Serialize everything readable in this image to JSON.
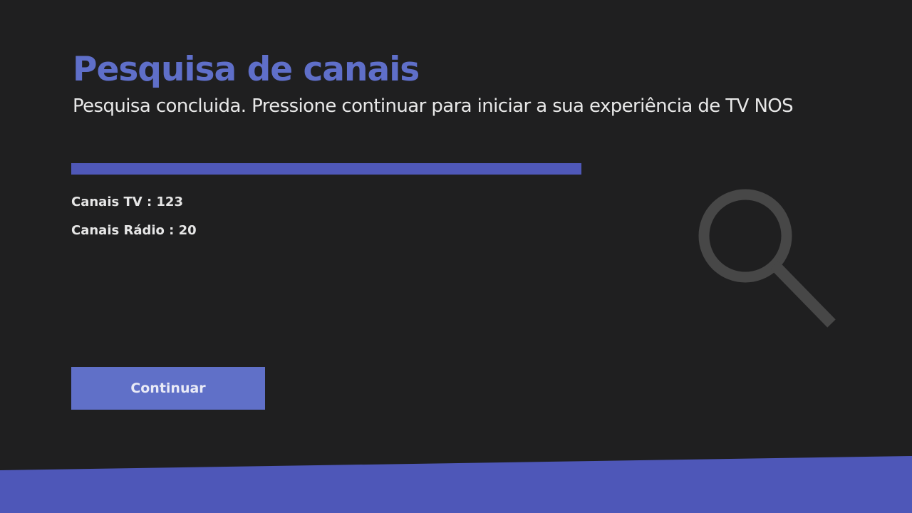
{
  "screen": {
    "title": "Pesquisa de canais",
    "subtitle": "Pesquisa concluida. Pressione continuar para iniciar a sua experiência de TV NOS"
  },
  "progress": {
    "value_percent": 100
  },
  "results": {
    "tv_channels_label": "Canais TV : 123",
    "radio_channels_label": "Canais Rádio : 20"
  },
  "actions": {
    "continue_label": "Continuar"
  },
  "illustration": {
    "icon": "search-icon"
  },
  "colors": {
    "background": "#1f1f20",
    "accent": "#5f6fc9",
    "progress_fill": "#4f58b8",
    "button": "#6070c8",
    "bottom_band": "#4e57b8",
    "icon": "#474747"
  }
}
